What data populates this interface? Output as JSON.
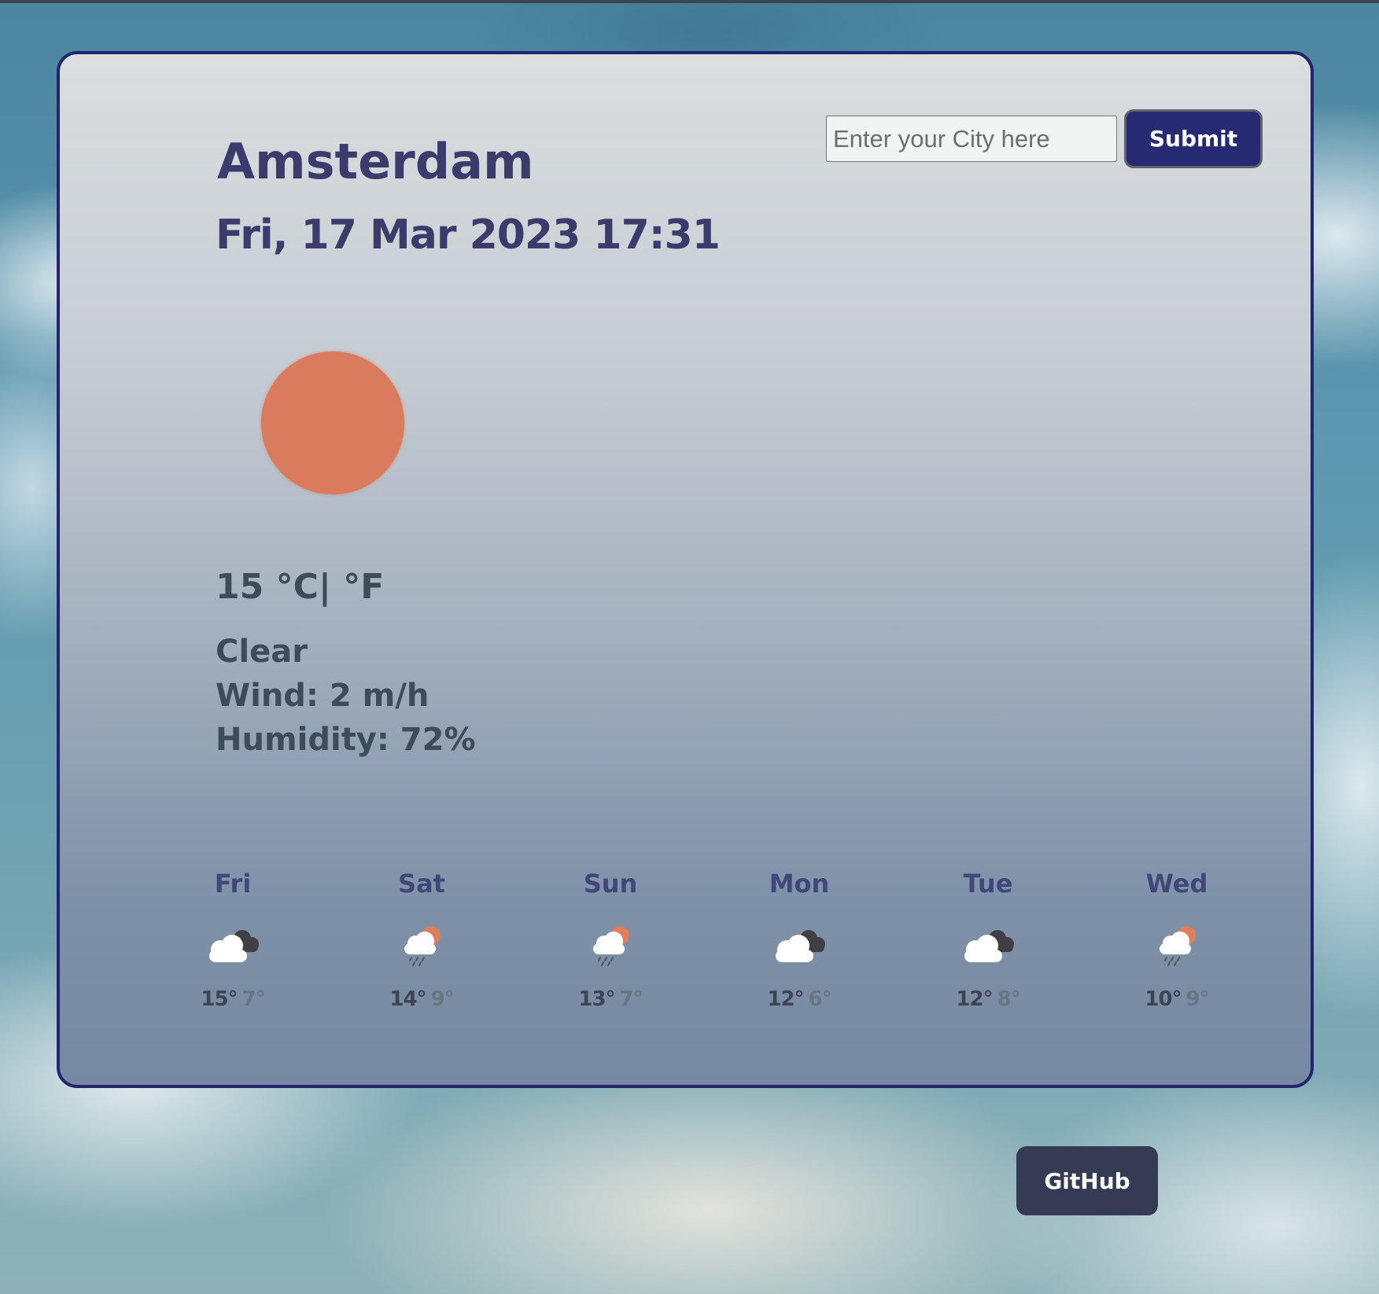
{
  "search": {
    "placeholder": "Enter your City here",
    "value": "",
    "submit_label": "Submit"
  },
  "current": {
    "city": "Amsterdam",
    "datetime": "Fri, 17 Mar 2023 17:31",
    "icon": "sun-icon",
    "temperature": "15",
    "unit_celsius": "°C",
    "unit_separator": "|",
    "unit_fahrenheit": "°F",
    "description": "Clear",
    "wind": "Wind: 2 m/h",
    "humidity": "Humidity: 72%"
  },
  "forecast": [
    {
      "day": "Fri",
      "icon": "cloud-dark-cloud-icon",
      "max": "15°",
      "min": "7°"
    },
    {
      "day": "Sat",
      "icon": "rain-sun-cloud-icon",
      "max": "14°",
      "min": "9°"
    },
    {
      "day": "Sun",
      "icon": "rain-sun-cloud-icon",
      "max": "13°",
      "min": "7°"
    },
    {
      "day": "Mon",
      "icon": "cloud-dark-cloud-icon",
      "max": "12°",
      "min": "6°"
    },
    {
      "day": "Tue",
      "icon": "cloud-dark-cloud-icon",
      "max": "12°",
      "min": "8°"
    },
    {
      "day": "Wed",
      "icon": "rain-sun-cloud-icon",
      "max": "10°",
      "min": "9°"
    }
  ],
  "footer": {
    "github_label": "GitHub"
  },
  "colors": {
    "card_border": "#23266f",
    "heading_text": "#3b3c6b",
    "sun": "#d97c5e",
    "button_bg": "#262a73",
    "github_bg": "#343b52"
  }
}
